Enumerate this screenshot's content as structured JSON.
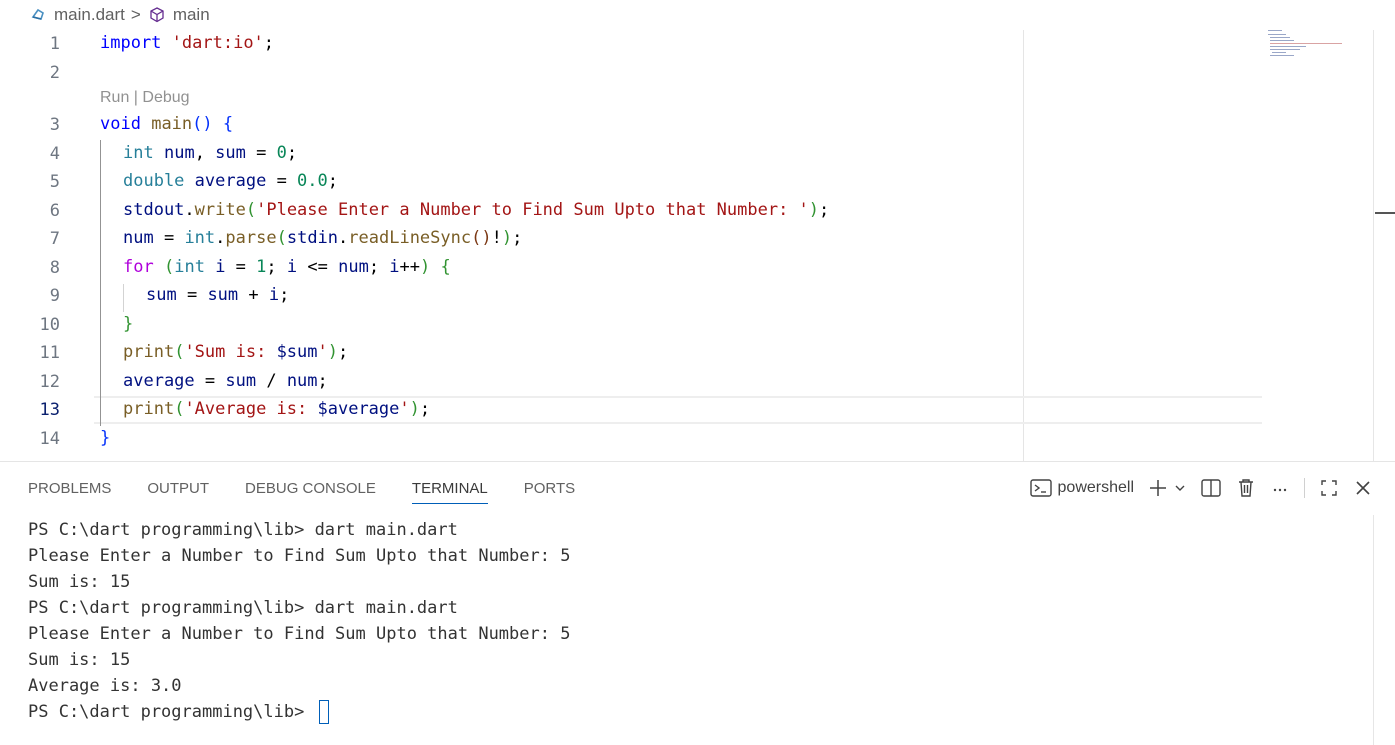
{
  "breadcrumb": {
    "file": "main.dart",
    "separator": ">",
    "symbol": "main"
  },
  "editor": {
    "codelens": "Run | Debug",
    "active_line": "13",
    "lines": [
      {
        "n": "1"
      },
      {
        "n": "2"
      },
      {
        "n": "3"
      },
      {
        "n": "4"
      },
      {
        "n": "5"
      },
      {
        "n": "6"
      },
      {
        "n": "7"
      },
      {
        "n": "8"
      },
      {
        "n": "9"
      },
      {
        "n": "10"
      },
      {
        "n": "11"
      },
      {
        "n": "12"
      },
      {
        "n": "13"
      },
      {
        "n": "14"
      }
    ],
    "tokens": {
      "l1": [
        "import",
        " ",
        "'dart:io'",
        ";"
      ],
      "l3": [
        "void",
        " ",
        "main",
        "()",
        " ",
        "{"
      ],
      "l4": [
        "int",
        " ",
        "num",
        ", ",
        "sum",
        " = ",
        "0",
        ";"
      ],
      "l5": [
        "double",
        " ",
        "average",
        " = ",
        "0.0",
        ";"
      ],
      "l6": [
        "stdout",
        ".",
        "write",
        "(",
        "'Please Enter a Number to Find Sum Upto that Number: '",
        ")",
        ";"
      ],
      "l7": [
        "num",
        " = ",
        "int",
        ".",
        "parse",
        "(",
        "stdin",
        ".",
        "readLineSync",
        "()",
        "!",
        ")",
        ";"
      ],
      "l8": [
        "for",
        " ",
        "(",
        "int",
        " ",
        "i",
        " = ",
        "1",
        "; ",
        "i",
        " <= ",
        "num",
        "; ",
        "i",
        "++",
        ")",
        " ",
        "{"
      ],
      "l9": [
        "sum",
        " = ",
        "sum",
        " + ",
        "i",
        ";"
      ],
      "l10": [
        "}"
      ],
      "l11": [
        "print",
        "(",
        "'Sum is: ",
        "$sum",
        "'",
        ")",
        ";"
      ],
      "l12": [
        "average",
        " = ",
        "sum",
        " / ",
        "num",
        ";"
      ],
      "l13": [
        "print",
        "(",
        "'Average is: ",
        "$average",
        "'",
        ")",
        ";"
      ],
      "l14": [
        "}"
      ]
    }
  },
  "panel": {
    "tabs": [
      {
        "label": "PROBLEMS"
      },
      {
        "label": "OUTPUT"
      },
      {
        "label": "DEBUG CONSOLE"
      },
      {
        "label": "TERMINAL",
        "active": true
      },
      {
        "label": "PORTS"
      }
    ],
    "shell": "powershell",
    "icons": [
      "terminal-icon",
      "plus-icon",
      "chevron-down-icon",
      "split-icon",
      "trash-icon",
      "more-icon",
      "maximize-icon",
      "close-icon"
    ],
    "terminal_lines": [
      "PS C:\\dart programming\\lib> dart main.dart",
      "Please Enter a Number to Find Sum Upto that Number: 5",
      "Sum is: 15",
      "PS C:\\dart programming\\lib> dart main.dart",
      "Please Enter a Number to Find Sum Upto that Number: 5",
      "Sum is: 15",
      "Average is: 3.0",
      "PS C:\\dart programming\\lib> "
    ]
  },
  "colors": {
    "keyword": "#0000ff",
    "control": "#af00db",
    "type": "#267f99",
    "string": "#a31515",
    "number": "#098658",
    "variable": "#001080",
    "function": "#795e26",
    "accent": "#005fb8"
  }
}
